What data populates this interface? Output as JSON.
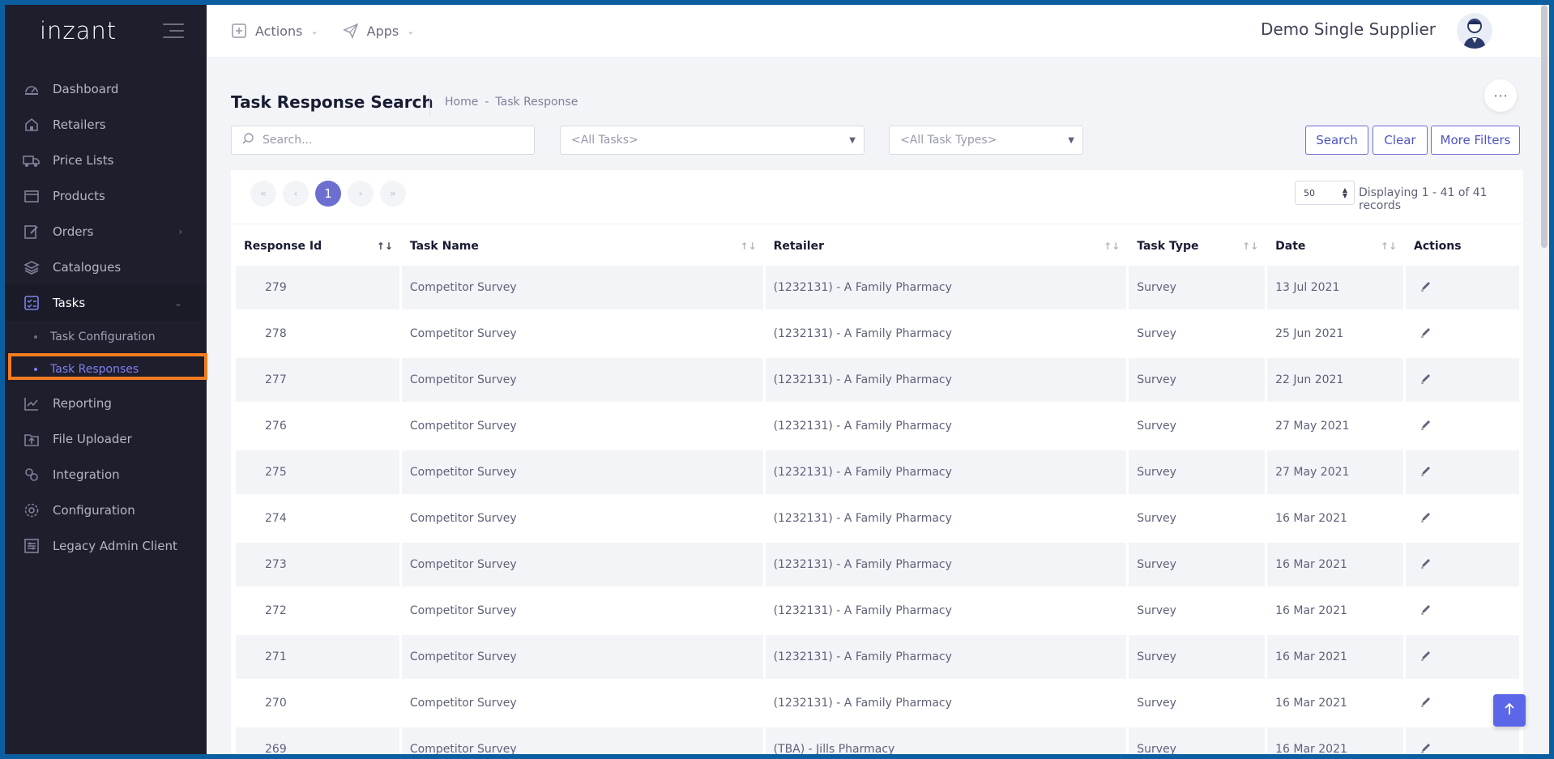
{
  "app": {
    "logo": "inzant"
  },
  "sidebar": {
    "items": [
      {
        "label": "Dashboard",
        "icon": "dashboard-icon"
      },
      {
        "label": "Retailers",
        "icon": "home-icon"
      },
      {
        "label": "Price Lists",
        "icon": "truck-icon"
      },
      {
        "label": "Products",
        "icon": "box-icon"
      },
      {
        "label": "Orders",
        "icon": "edit-icon",
        "chevron": "›"
      },
      {
        "label": "Catalogues",
        "icon": "layers-icon"
      },
      {
        "label": "Tasks",
        "icon": "tasks-icon",
        "chevron": "⌄"
      }
    ],
    "tasks_sub": [
      {
        "label": "Task Configuration"
      },
      {
        "label": "Task Responses"
      }
    ],
    "items_after": [
      {
        "label": "Reporting",
        "icon": "chart-icon"
      },
      {
        "label": "File Uploader",
        "icon": "file-upload-icon"
      },
      {
        "label": "Integration",
        "icon": "integration-icon"
      },
      {
        "label": "Configuration",
        "icon": "gear-icon"
      },
      {
        "label": "Legacy Admin Client",
        "icon": "settings-list-icon"
      }
    ]
  },
  "header": {
    "actions_label": "Actions",
    "apps_label": "Apps",
    "user_name": "Demo Single Supplier"
  },
  "subheader": {
    "title": "Task Response Search",
    "breadcrumb": [
      "Home",
      "-",
      "Task Response"
    ]
  },
  "filters": {
    "search_placeholder": "Search...",
    "tasks_select": "<All Tasks>",
    "task_types_select": "<All Task Types>",
    "search_button": "Search",
    "clear_button": "Clear",
    "more_filters_button": "More Filters"
  },
  "pagination": {
    "current_page": "1",
    "page_size": "50",
    "displaying": "Displaying 1 - 41 of 41 records"
  },
  "table": {
    "columns": [
      "Response Id",
      "Task Name",
      "Retailer",
      "Task Type",
      "Date",
      "Actions"
    ],
    "rows": [
      {
        "id": "279",
        "task": "Competitor Survey",
        "retailer": "(1232131) - A Family Pharmacy",
        "type": "Survey",
        "date": "13 Jul 2021"
      },
      {
        "id": "278",
        "task": "Competitor Survey",
        "retailer": "(1232131) - A Family Pharmacy",
        "type": "Survey",
        "date": "25 Jun 2021"
      },
      {
        "id": "277",
        "task": "Competitor Survey",
        "retailer": "(1232131) - A Family Pharmacy",
        "type": "Survey",
        "date": "22 Jun 2021"
      },
      {
        "id": "276",
        "task": "Competitor Survey",
        "retailer": "(1232131) - A Family Pharmacy",
        "type": "Survey",
        "date": "27 May 2021"
      },
      {
        "id": "275",
        "task": "Competitor Survey",
        "retailer": "(1232131) - A Family Pharmacy",
        "type": "Survey",
        "date": "27 May 2021"
      },
      {
        "id": "274",
        "task": "Competitor Survey",
        "retailer": "(1232131) - A Family Pharmacy",
        "type": "Survey",
        "date": "16 Mar 2021"
      },
      {
        "id": "273",
        "task": "Competitor Survey",
        "retailer": "(1232131) - A Family Pharmacy",
        "type": "Survey",
        "date": "16 Mar 2021"
      },
      {
        "id": "272",
        "task": "Competitor Survey",
        "retailer": "(1232131) - A Family Pharmacy",
        "type": "Survey",
        "date": "16 Mar 2021"
      },
      {
        "id": "271",
        "task": "Competitor Survey",
        "retailer": "(1232131) - A Family Pharmacy",
        "type": "Survey",
        "date": "16 Mar 2021"
      },
      {
        "id": "270",
        "task": "Competitor Survey",
        "retailer": "(1232131) - A Family Pharmacy",
        "type": "Survey",
        "date": "16 Mar 2021"
      },
      {
        "id": "269",
        "task": "Competitor Survey",
        "retailer": "(TBA) - Jills Pharmacy",
        "type": "Survey",
        "date": "16 Mar 2021"
      }
    ]
  },
  "colors": {
    "sidebar_bg": "#1e1e2d",
    "accent": "#6c6fd0",
    "highlight": "#f47c20",
    "frame": "#0b5fa0"
  }
}
